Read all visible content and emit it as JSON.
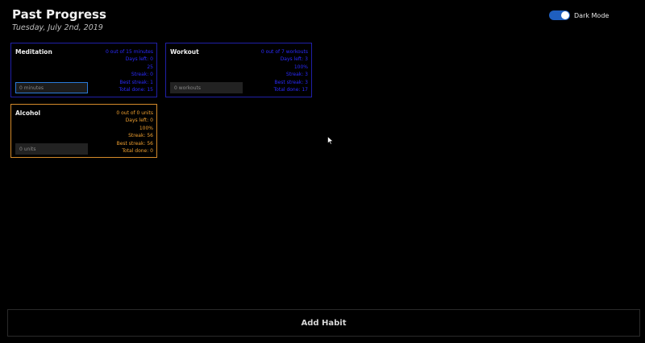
{
  "header": {
    "title": "Past Progress",
    "date": "Tuesday, July 2nd, 2019"
  },
  "dark_mode": {
    "label": "Dark Mode",
    "enabled": true,
    "toggle_color": "#1f5fbf"
  },
  "habits": [
    {
      "name": "Meditation",
      "color": "#2b2bff",
      "border_color": "#2020a8",
      "stats": {
        "progress": "0 out of 15 minutes",
        "days_left": "Days left: 0",
        "percent": "25",
        "streak": "Streak: 0",
        "best_streak": "Best streak: 1",
        "total_done": "Total done: 15"
      },
      "input_placeholder": "0 minutes",
      "input_focused": true
    },
    {
      "name": "Workout",
      "color": "#2b2bff",
      "border_color": "#2020a8",
      "stats": {
        "progress": "0 out of 7 workouts",
        "days_left": "Days left: 3",
        "percent": "100%",
        "streak": "Streak: 3",
        "best_streak": "Best streak: 3",
        "total_done": "Total done: 17"
      },
      "input_placeholder": "0 workouts",
      "input_focused": false
    },
    {
      "name": "Alcohol",
      "color": "#f0a030",
      "border_color": "#d48a2a",
      "stats": {
        "progress": "0 out of 0 units",
        "days_left": "Days left: 0",
        "percent": "100%",
        "streak": "Streak: 56",
        "best_streak": "Best streak: 56",
        "total_done": "Total done: 0"
      },
      "input_placeholder": "0 units",
      "input_focused": false
    }
  ],
  "add_habit": {
    "label": "Add Habit"
  }
}
